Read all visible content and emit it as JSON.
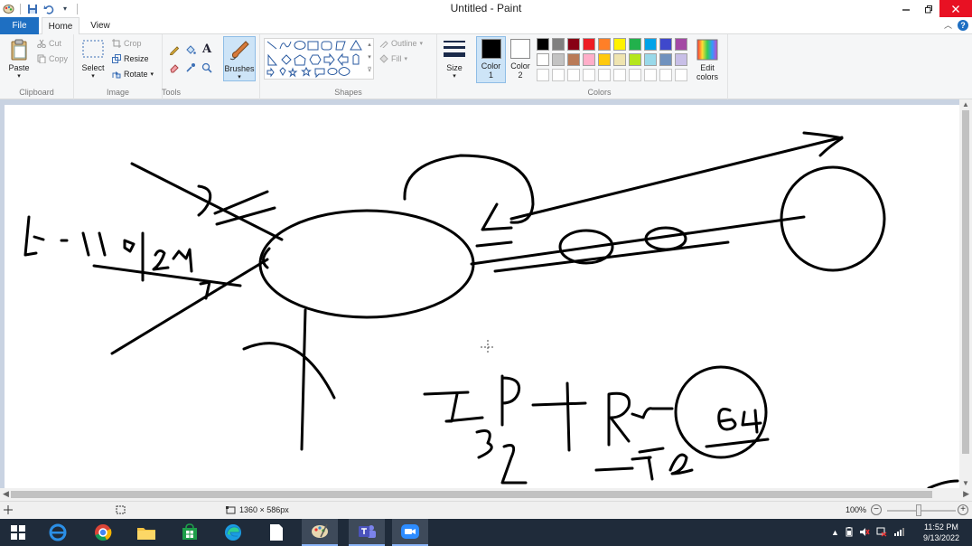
{
  "window": {
    "title": "Untitled - Paint"
  },
  "tabs": [
    {
      "label": "File"
    },
    {
      "label": "Home"
    },
    {
      "label": "View"
    }
  ],
  "ribbon": {
    "clipboard": {
      "label": "Clipboard",
      "paste": "Paste",
      "cut": "Cut",
      "copy": "Copy"
    },
    "image": {
      "label": "Image",
      "select": "Select",
      "crop": "Crop",
      "resize": "Resize",
      "rotate": "Rotate"
    },
    "tools": {
      "label": "Tools",
      "brushes": "Brushes"
    },
    "shapes": {
      "label": "Shapes",
      "outline": "Outline",
      "fill": "Fill"
    },
    "size": {
      "label": "Size"
    },
    "colors": {
      "label": "Colors",
      "color1_label": "Color",
      "color1_num": "1",
      "color2_label": "Color",
      "color2_num": "2",
      "edit_label": "Edit",
      "edit_label2": "colors",
      "color1_value": "#000000",
      "color2_value": "#ffffff",
      "palette_row1": [
        "#000000",
        "#7f7f7f",
        "#880015",
        "#ed1c24",
        "#ff7f27",
        "#fff200",
        "#22b14c",
        "#00a2e8",
        "#3f48cc",
        "#a349a4"
      ],
      "palette_row2": [
        "#ffffff",
        "#c3c3c3",
        "#b97a57",
        "#ffaec9",
        "#ffc90e",
        "#efe4b0",
        "#b5e61d",
        "#99d9ea",
        "#7092be",
        "#c8bfe7"
      ],
      "palette_row3": [
        "#ffffff",
        "#ffffff",
        "#ffffff",
        "#ffffff",
        "#ffffff",
        "#ffffff",
        "#ffffff",
        "#ffffff",
        "#ffffff",
        "#ffffff"
      ]
    }
  },
  "statusbar": {
    "dimensions": "1360 × 586px",
    "zoom": "100%"
  },
  "taskbar": {
    "time": "11:52 PM",
    "date": "9/13/2022"
  }
}
